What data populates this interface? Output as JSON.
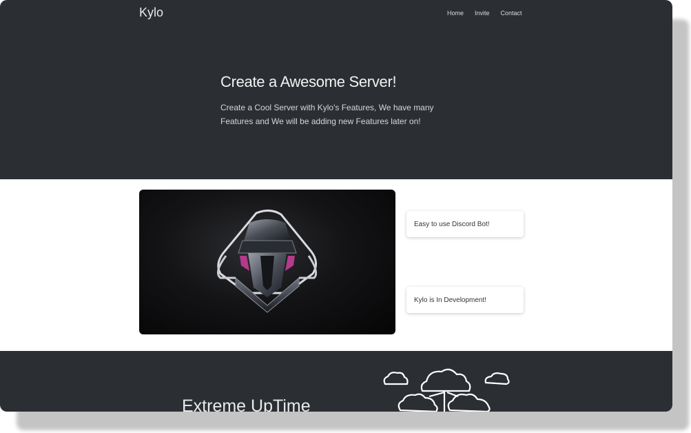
{
  "header": {
    "brand": "Kylo",
    "nav": [
      {
        "label": "Home"
      },
      {
        "label": "Invite"
      },
      {
        "label": "Contact"
      }
    ]
  },
  "hero": {
    "title": "Create a Awesome Server!",
    "subtitle": "Create a Cool Server with Kylo's Features, We have many Features and We will be adding new Features later on!"
  },
  "features": {
    "items": [
      {
        "label": "Easy to use Discord Bot!"
      },
      {
        "label": "Kylo is In Development!"
      }
    ],
    "image_icon": "kylo-helmet-icon"
  },
  "uptime": {
    "title": "Extreme UpTime",
    "icon": "cloud-network-icon"
  },
  "colors": {
    "dark_bg": "#2b2f33",
    "light_bg": "#ffffff"
  }
}
